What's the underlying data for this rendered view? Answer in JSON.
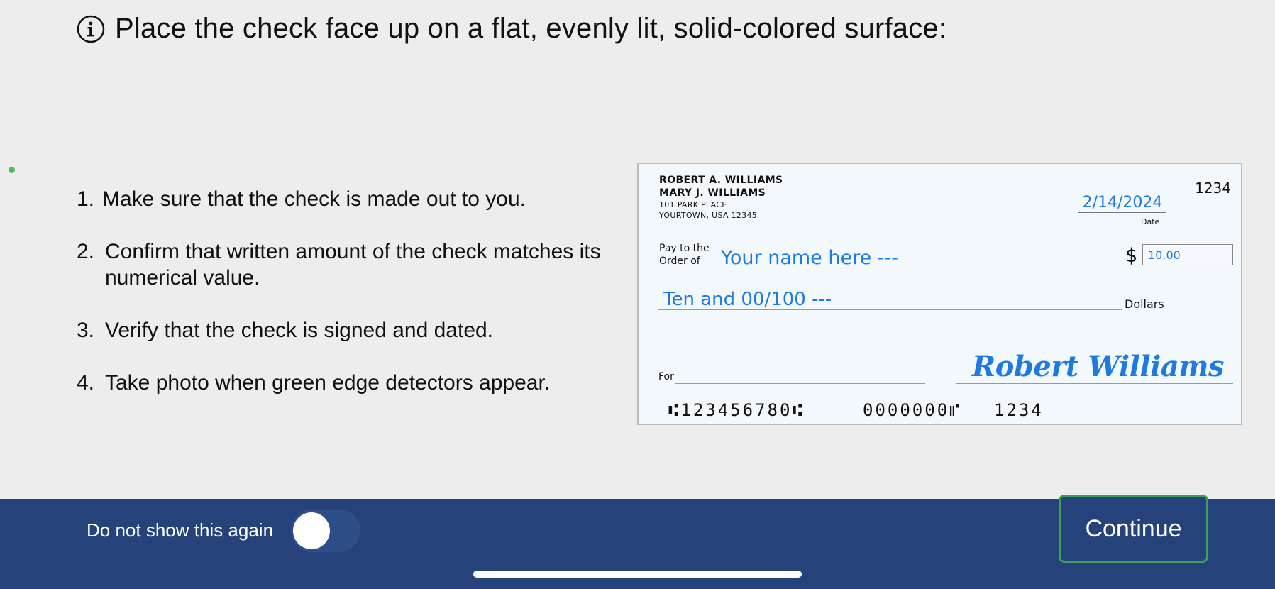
{
  "header": {
    "title": "Place the check face up on a flat, evenly lit, solid-colored surface:",
    "icon": "info-icon"
  },
  "steps": [
    {
      "num": "1.",
      "text": "Make sure that the check is made out to you."
    },
    {
      "num": "2.",
      "text": "Confirm that written amount of the check matches its numerical value."
    },
    {
      "num": "3.",
      "text": "Verify that the check is signed and dated."
    },
    {
      "num": "4.",
      "text": "Take photo when green edge detectors appear."
    }
  ],
  "check": {
    "owner_line1": "ROBERT A. WILLIAMS",
    "owner_line2": "MARY J. WILLIAMS",
    "address_line1": "101 PARK PLACE",
    "address_line2": "YOURTOWN, USA 12345",
    "check_number": "1234",
    "date_value": "2/14/2024",
    "date_label": "Date",
    "pay_to_label_1": "Pay to the",
    "pay_to_label_2": "Order of",
    "payee": "Your name here ---",
    "dollar_sign": "$",
    "amount": "10.00",
    "written_amount": "Ten and 00/100 ---",
    "dollars_label": "Dollars",
    "for_label": "For",
    "signature": "Robert Williams",
    "micr_routing": "⑆123456780⑆",
    "micr_account": "0000000⑈",
    "micr_check": "1234",
    "colors": {
      "ink": "#1f7ae0",
      "paper": "#f3f8fd"
    }
  },
  "footer": {
    "toggle_label": "Do not show this again",
    "toggle_on": false,
    "continue_label": "Continue",
    "colors": {
      "background": "#25427b",
      "focus": "#3aa05a"
    }
  }
}
